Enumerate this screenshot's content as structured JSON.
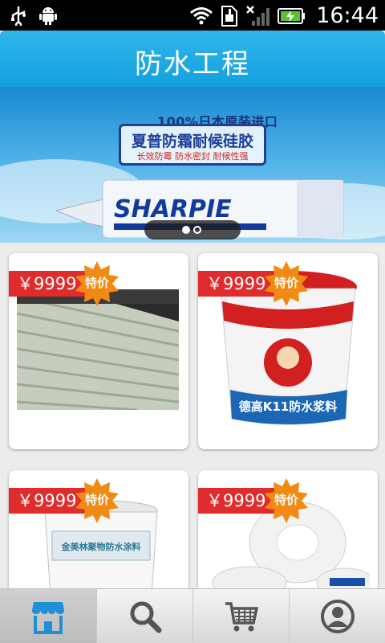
{
  "status": {
    "time": "16:44"
  },
  "header": {
    "title": "防水工程"
  },
  "banner": {
    "tagline": "100%日本原装进口",
    "product_title": "夏普防霜耐候硅胶",
    "features": "长效防霉  防水密封  耐候性强",
    "brand": "SHARPIE",
    "slides": 2,
    "active_slide": 1
  },
  "products": [
    {
      "price": "￥9999",
      "badge": "特价",
      "image": "corrugated-translucent-sheet"
    },
    {
      "price": "￥9999",
      "badge": "特价",
      "image": "red-bucket-k11-waterproof-slurry",
      "label": "德高K11防水浆料"
    },
    {
      "price": "￥9999",
      "badge": "特价",
      "image": "white-bucket-coating",
      "label": "金美林聚物防水涂料"
    },
    {
      "price": "￥9999",
      "badge": "特价",
      "image": "ptfe-tape-rolls"
    }
  ],
  "nav": {
    "tabs": [
      {
        "icon": "store-icon",
        "active": true
      },
      {
        "icon": "search-icon",
        "active": false
      },
      {
        "icon": "cart-icon",
        "active": false
      },
      {
        "icon": "user-icon",
        "active": false
      }
    ]
  },
  "colors": {
    "header": "#1da7e2",
    "price_tag": "#e02c2c",
    "badge": "#f08a12",
    "active_tab_icon": "#1f8fd6",
    "inactive_tab_icon": "#555555"
  }
}
